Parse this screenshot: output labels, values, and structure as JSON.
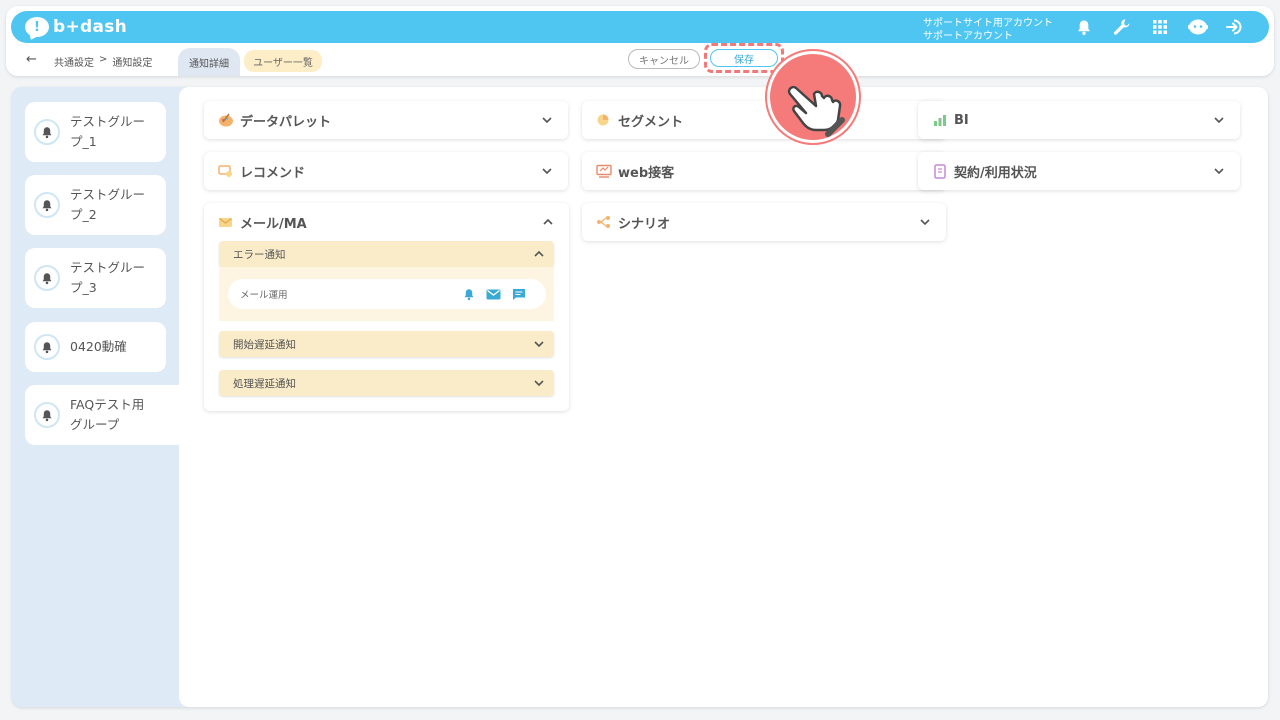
{
  "logo": {
    "text": "b+dash",
    "mark": "!"
  },
  "account": {
    "line1": "サポートサイト用アカウント",
    "line2": "サポートアカウント"
  },
  "top_icons": [
    "bell-icon",
    "wrench-icon",
    "grid-icon",
    "robot-icon",
    "logout-icon"
  ],
  "subbar": {
    "back": "←",
    "breadcrumb": [
      "共通設定",
      ">",
      "通知設定"
    ],
    "tab_detail": "通知詳細",
    "tab_users": "ユーザー一覧",
    "cancel": "キャンセル",
    "save": "保存"
  },
  "groups": [
    {
      "label": "テストグループ_1"
    },
    {
      "label": "テストグループ_2"
    },
    {
      "label": "テストグループ_3"
    },
    {
      "label": "0420動確"
    },
    {
      "label": "FAQテスト用グループ"
    }
  ],
  "categories": {
    "datapalette": "データパレット",
    "segment": "セグメント",
    "bi": "BI",
    "recommend": "レコメンド",
    "web": "web接客",
    "contract": "契約/利用状況",
    "mail": "メール/MA",
    "scenario": "シナリオ"
  },
  "mail_sections": {
    "error": "エラー通知",
    "error_item": "メール運用",
    "start_delay": "開始遅延通知",
    "process_delay": "処理遅延通知"
  },
  "colors": {
    "brand": "#4fc6f2",
    "sub_accent": "#faecc9",
    "highlight": "#f57a7a"
  }
}
